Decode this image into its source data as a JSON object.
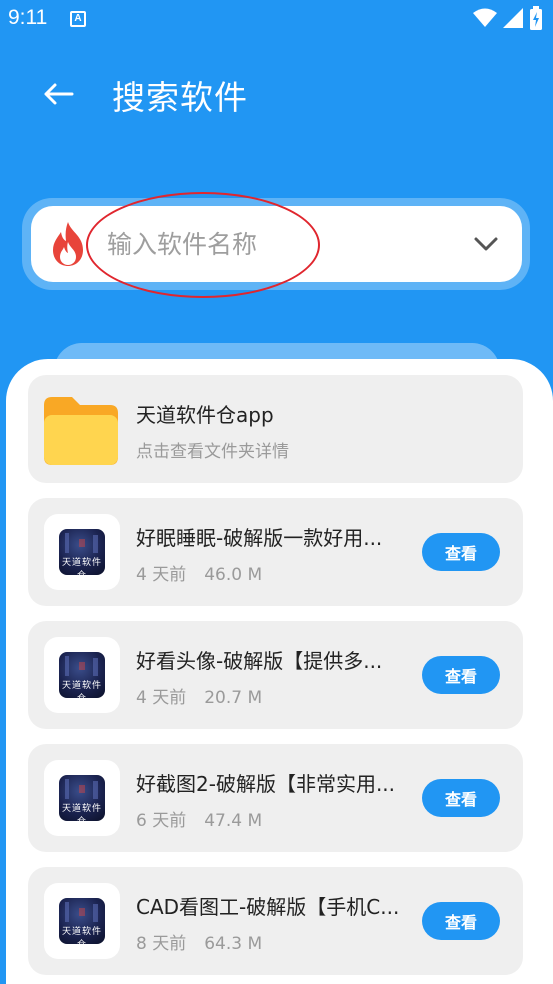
{
  "status_bar": {
    "time": "9:11",
    "notification_icon": "a-icon",
    "icons": [
      "wifi-icon",
      "signal-icon",
      "battery-icon"
    ]
  },
  "app_bar": {
    "title": "搜索软件",
    "back_icon": "arrow-left-icon"
  },
  "search": {
    "placeholder": "输入软件名称",
    "value": "",
    "leading_icon": "fire-icon",
    "trailing_icon": "chevron-down-icon"
  },
  "folder_item": {
    "title": "天道软件仓app",
    "subtitle": "点击查看文件夹详情",
    "icon": "folder-icon"
  },
  "apps": [
    {
      "title": "好眠睡眠-破解版一款好用...",
      "age": "4 天前",
      "size": "46.0 M",
      "action": "查看",
      "icon_text": "天道软件仓"
    },
    {
      "title": "好看头像-破解版【提供多...",
      "age": "4 天前",
      "size": "20.7 M",
      "action": "查看",
      "icon_text": "天道软件仓"
    },
    {
      "title": "好截图2-破解版【非常实用...",
      "age": "6 天前",
      "size": "47.4 M",
      "action": "查看",
      "icon_text": "天道软件仓"
    },
    {
      "title": "CAD看图工-破解版【手机C...",
      "age": "8 天前",
      "size": "64.3 M",
      "action": "查看",
      "icon_text": "天道软件仓"
    }
  ],
  "colors": {
    "primary": "#2196F3",
    "card": "#efefef",
    "annotation": "#e0262e",
    "folder": "#FFD54F"
  }
}
